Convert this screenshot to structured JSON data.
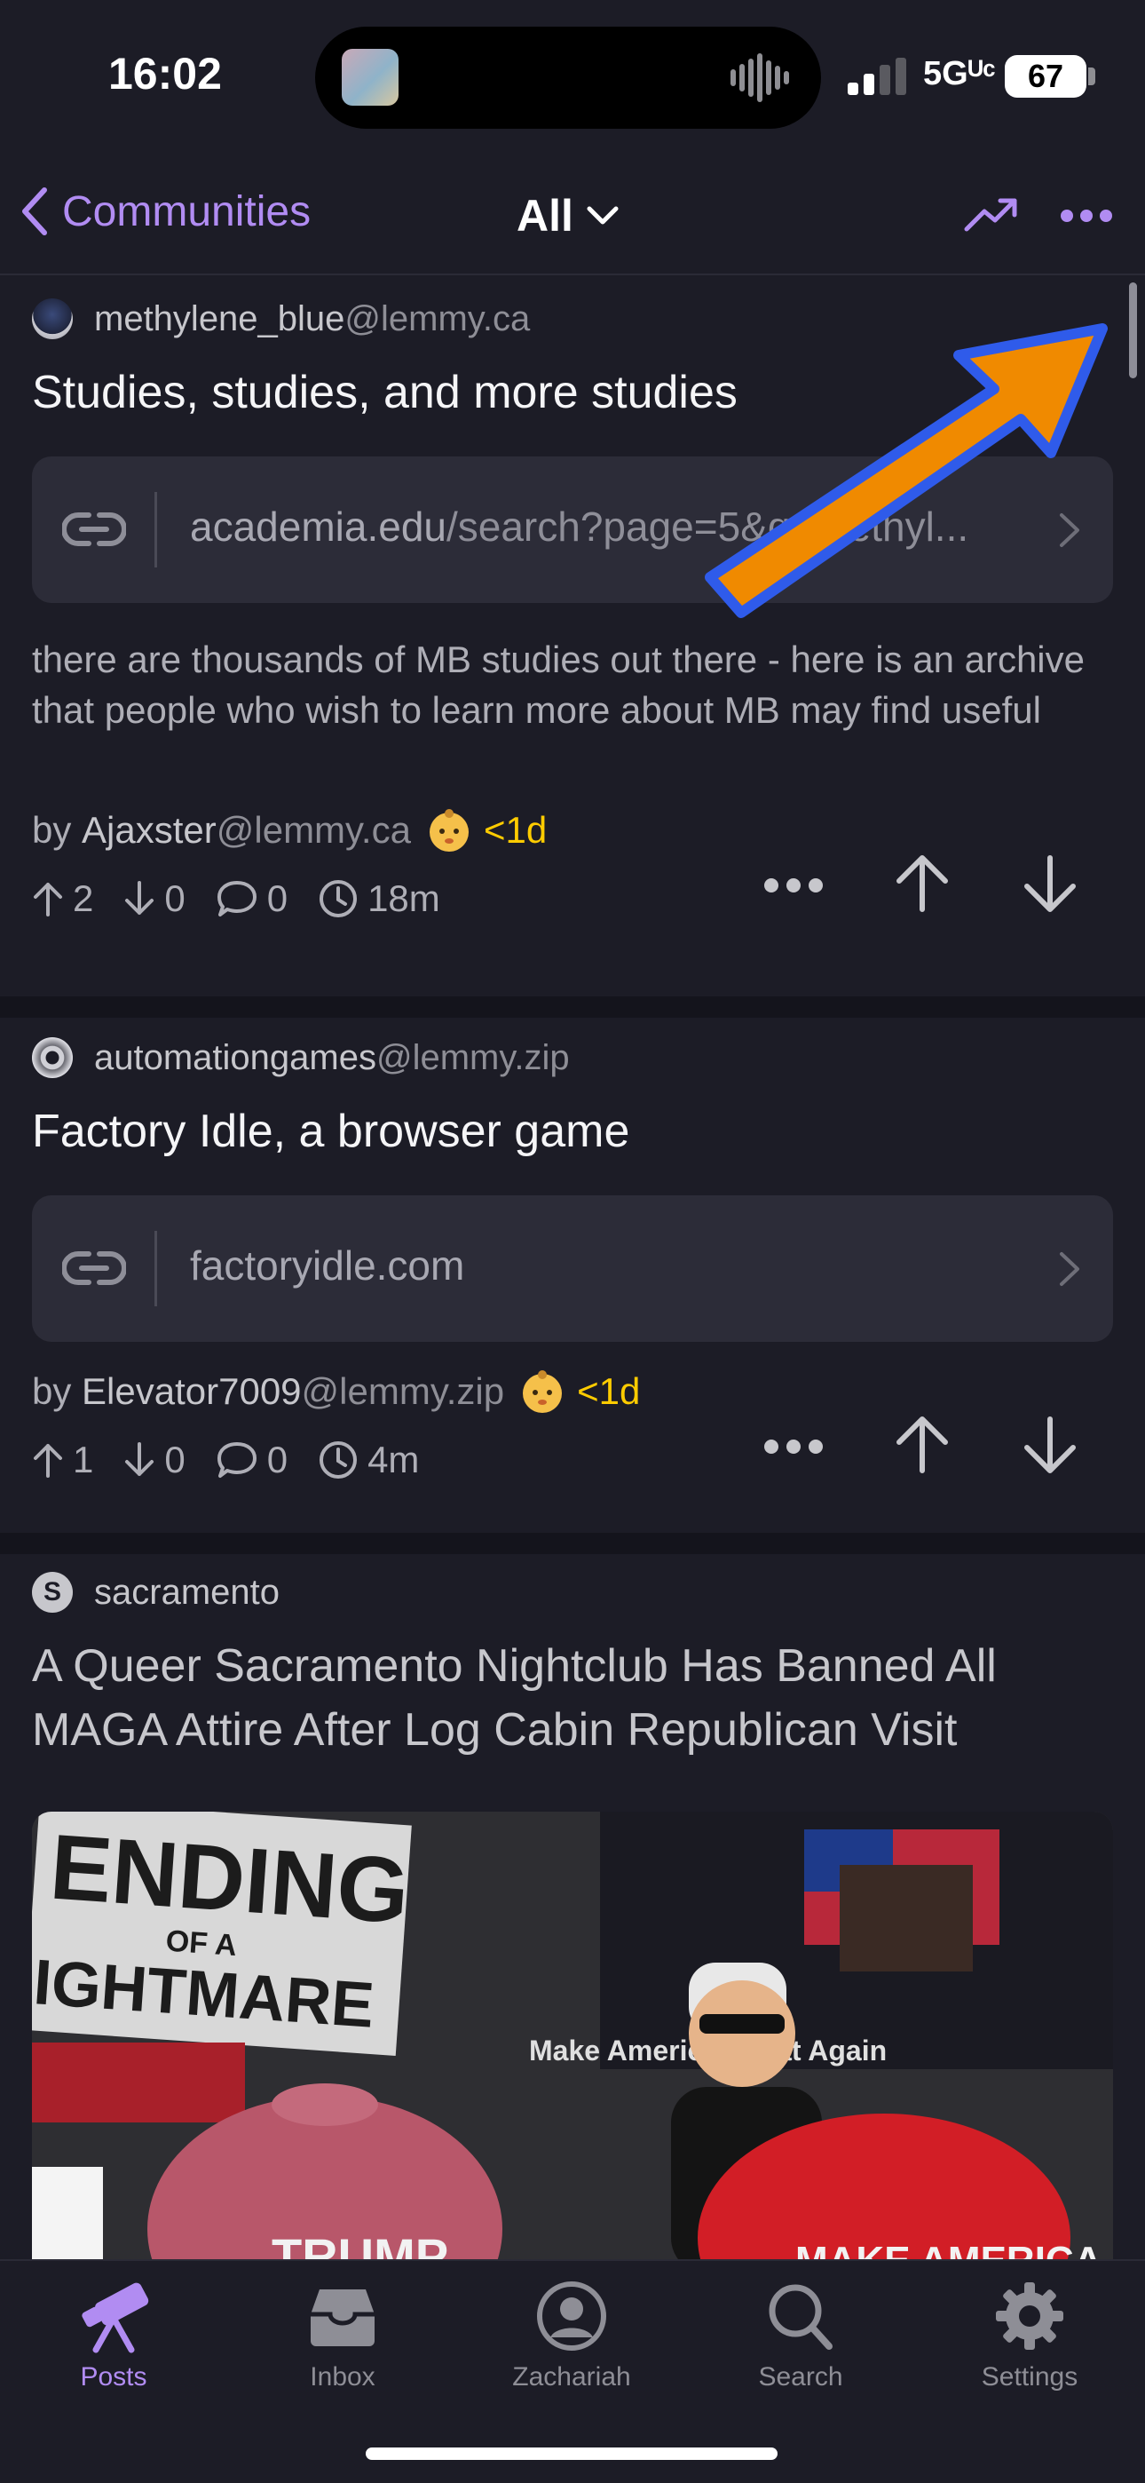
{
  "status_bar": {
    "time": "16:02",
    "network": "5Gᵁᶜ",
    "battery": "67"
  },
  "navbar": {
    "back_label": "Communities",
    "feed_label": "All",
    "icons": [
      "chevron-left-icon",
      "chevron-down-icon",
      "trending-icon",
      "more-icon"
    ]
  },
  "posts": [
    {
      "community_name": "methylene_blue",
      "community_instance": "@lemmy.ca",
      "title": "Studies, studies, and more studies",
      "link_domain": "academia.edu",
      "link_path": "/search?page=5&q=methyl...",
      "body": "there are thousands of MB studies out there - here is an archive that people who wish to learn more about MB may find useful",
      "by_prefix": "by ",
      "author": "Ajaxster",
      "author_instance": "@lemmy.ca",
      "age": "<1d",
      "upvotes": "2",
      "downvotes": "0",
      "comments": "0",
      "time": "18m"
    },
    {
      "community_name": "automationgames",
      "community_instance": "@lemmy.zip",
      "title": "Factory Idle, a browser game",
      "link_domain": "factoryidle.com",
      "link_path": "",
      "by_prefix": "by ",
      "author": "Elevator7009",
      "author_instance": "@lemmy.zip",
      "age": "<1d",
      "upvotes": "1",
      "downvotes": "0",
      "comments": "0",
      "time": "4m"
    },
    {
      "community_name": "sacramento",
      "community_instance": "",
      "avatar_letter": "S",
      "title": "A Queer Sacramento Nightclub Has Banned All MAGA Attire After Log Cabin Republican Visit",
      "photo_text": [
        "ENDING",
        "OF A",
        "IGHTMARE",
        "Make America Great Again",
        "TRUMP",
        "MAKE AMERICA"
      ]
    }
  ],
  "tabbar": {
    "tabs": [
      {
        "label": "Posts",
        "icon": "telescope-icon",
        "active": true
      },
      {
        "label": "Inbox",
        "icon": "inbox-icon",
        "active": false
      },
      {
        "label": "Zachariah",
        "icon": "profile-icon",
        "active": false
      },
      {
        "label": "Search",
        "icon": "search-icon",
        "active": false
      },
      {
        "label": "Settings",
        "icon": "gear-icon",
        "active": false
      }
    ]
  },
  "colors": {
    "accent": "#b18cf2",
    "background": "#1c1c26",
    "age_badge": "#ffcc00",
    "annotation_arrow": "#f08a00",
    "annotation_arrow_border": "#2f5bea"
  }
}
